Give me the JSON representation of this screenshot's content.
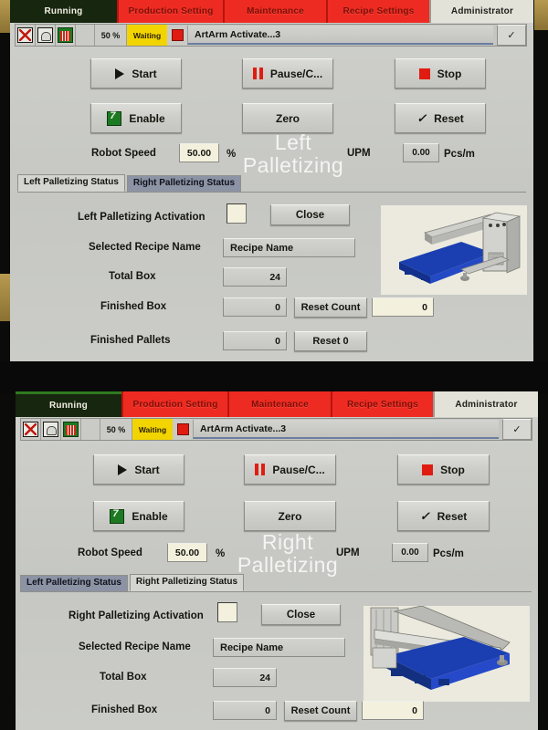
{
  "colors": {
    "red_tab": "#ee2b22",
    "green_tab": "#16260f",
    "green_accent": "#2f7a1f",
    "yellow_status": "#f2d400",
    "led_red": "#e01c12",
    "pallet_blue": "#1b3fb0",
    "panel_bg": "#c9cac6",
    "cream_field": "#f3f1de",
    "tab_inactive": "#8c93a4"
  },
  "nav": {
    "tabs": [
      {
        "label": "Running",
        "style": "running"
      },
      {
        "label": "Production Setting",
        "style": "red"
      },
      {
        "label": "Maintenance",
        "style": "red"
      },
      {
        "label": "Recipe Settings",
        "style": "red"
      },
      {
        "label": "Administrator",
        "style": "admin"
      }
    ]
  },
  "toolbar": {
    "icons": [
      "hourglass-icon",
      "hand-icon",
      "barrier-icon"
    ],
    "percent": "50 %",
    "state": "Waiting",
    "led": "alarm-led",
    "message": "ArtArm Activate...3",
    "confirm": "✓"
  },
  "controls": {
    "start": "Start",
    "pause": "Pause/C...",
    "stop": "Stop",
    "enable": "Enable",
    "zero": "Zero",
    "reset": "Reset"
  },
  "speed": {
    "robot_speed_label": "Robot Speed",
    "robot_speed_value": "50.00",
    "percent_unit": "%",
    "upm_label": "UPM",
    "upm_value": "0.00",
    "upm_unit": "Pcs/m"
  },
  "panel_top": {
    "watermark_line1": "Left",
    "watermark_line2": "Palletizing",
    "tabs": [
      {
        "label": "Left Palletizing Status",
        "state": "active"
      },
      {
        "label": "Right Palletizing Status",
        "state": "inactive"
      }
    ],
    "activation_label": "Left Palletizing Activation",
    "activation_checked": "",
    "close_button": "Close",
    "recipe_label": "Selected Recipe Name",
    "recipe_value": "Recipe Name",
    "total_box_label": "Total Box",
    "total_box_value": "24",
    "finished_box_label": "Finished Box",
    "finished_box_value": "0",
    "reset_count_button": "Reset Count",
    "reset_count_value": "0",
    "finished_pallets_label": "Finished Pallets",
    "finished_pallets_value": "0",
    "reset_pallets_button": "Reset 0"
  },
  "panel_bottom": {
    "watermark_line1": "Right",
    "watermark_line2": "Palletizing",
    "tabs": [
      {
        "label": "Left Palletizing Status",
        "state": "inactive"
      },
      {
        "label": "Right Palletizing Status",
        "state": "active"
      }
    ],
    "activation_label": "Right Palletizing Activation",
    "activation_checked": "",
    "close_button": "Close",
    "recipe_label": "Selected Recipe Name",
    "recipe_value": "Recipe Name",
    "total_box_label": "Total Box",
    "total_box_value": "24",
    "finished_box_label": "Finished Box",
    "finished_box_value": "0",
    "reset_count_button": "Reset Count",
    "reset_count_value": "0"
  }
}
